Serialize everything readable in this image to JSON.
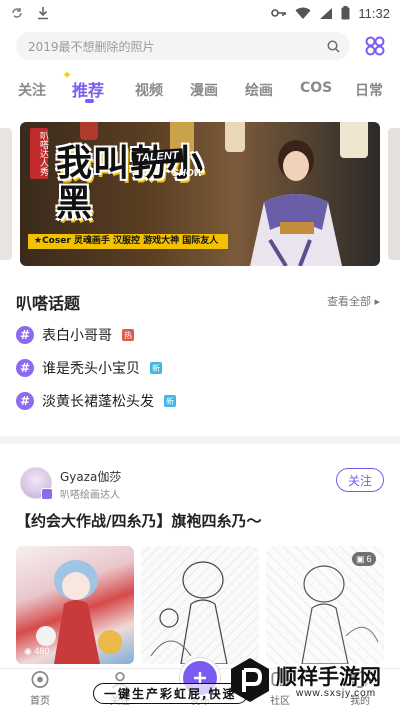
{
  "status_bar": {
    "time": "11:32"
  },
  "search": {
    "placeholder": "2019最不想删除的照片"
  },
  "tabs": [
    {
      "label": "关注"
    },
    {
      "label": "推荐"
    },
    {
      "label": "视频"
    },
    {
      "label": "漫画"
    },
    {
      "label": "绘画"
    },
    {
      "label": "COS"
    },
    {
      "label": "日常"
    }
  ],
  "banner": {
    "vertical_label": "叭嗒达人秀",
    "title": "我叫勃小黑",
    "talent": "TALENT",
    "show": "SHOW",
    "strip": "★Coser  灵魂画手  汉服控  游戏大神  国际友人"
  },
  "topics_section": {
    "title": "叭嗒话题",
    "see_all": "查看全部"
  },
  "topics": [
    {
      "label": "表白小哥哥",
      "badge": "热",
      "badge_color": "#e2574c"
    },
    {
      "label": "谁是秃头小宝贝",
      "badge": "新",
      "badge_color": "#3fb8e8"
    },
    {
      "label": "淡黄长裙蓬松头发",
      "badge": "新",
      "badge_color": "#3fb8e8"
    }
  ],
  "post": {
    "author": "Gyaza伽莎",
    "role": "叭嗒绘画达人",
    "follow": "关注",
    "title": "【约会大作战/四糸乃】旗袍四糸乃～",
    "thumb_count": "480",
    "multi_count": "6"
  },
  "bottom_nav": [
    {
      "label": "首页"
    },
    {
      "label": "关注"
    },
    {
      "label": "发布"
    },
    {
      "label": "社区"
    },
    {
      "label": "我的"
    }
  ],
  "watermark": {
    "slogan": "一键生产彩虹屁,快速",
    "brand": "顺祥手游网",
    "url": "www.sxsjy.com"
  },
  "colors": {
    "accent": "#7b5cf0",
    "hot_badge": "#e2574c",
    "new_badge": "#3fb8e8"
  }
}
